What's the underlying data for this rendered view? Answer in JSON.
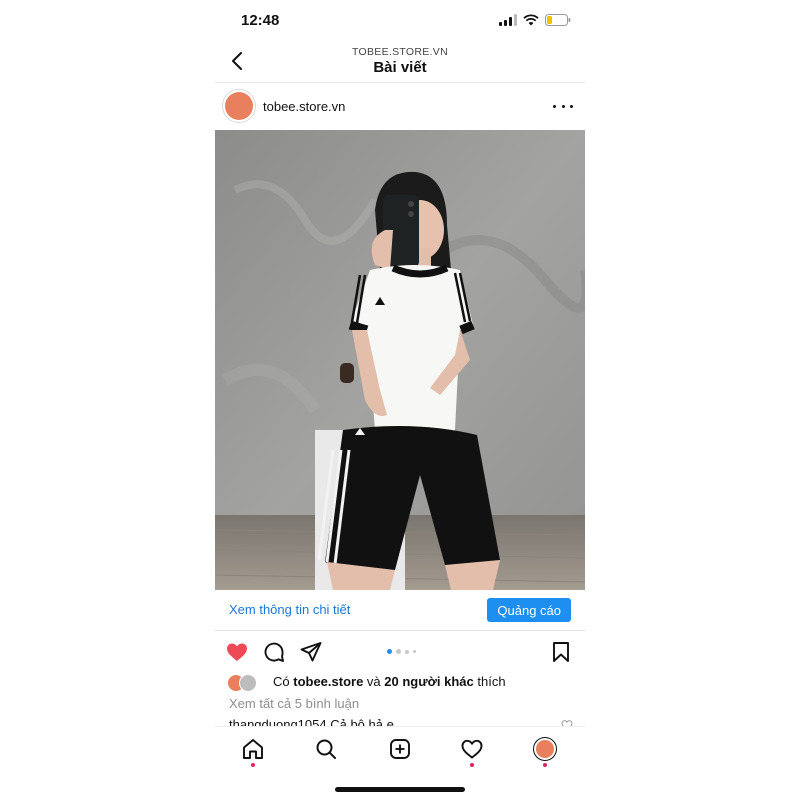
{
  "status_bar": {
    "time": "12:48"
  },
  "header": {
    "subtitle": "TOBEE.STORE.VN",
    "title": "Bài viết"
  },
  "post": {
    "username": "tobee.store.vn",
    "avatar_label": "tobee store",
    "image_icon": "adidas-white-tee-black-shorts-photo"
  },
  "cta": {
    "link_label": "Xem thông tin chi tiết",
    "button_label": "Quảng cáo"
  },
  "carousel": {
    "current_slide": 1,
    "slide_count": 4
  },
  "likes": {
    "prefix": "Có ",
    "user": "tobee.store",
    "middle": " và ",
    "others": "20 người khác",
    "suffix": " thích"
  },
  "comments": {
    "view_all": "Xem tất cả 5 bình luận",
    "preview_user": "thangduong1054",
    "preview_text": " Cả bộ hả e"
  },
  "colors": {
    "accent_blue": "#1c8ff0",
    "link_blue": "#1a78d8",
    "like_red": "#ed4956",
    "avatar_orange": "#e8805e"
  },
  "icons": {
    "back": "chevron-left-icon",
    "more": "more-horizontal-icon",
    "like": "heart-filled-icon",
    "comment": "comment-icon",
    "share": "paper-plane-icon",
    "save": "bookmark-icon",
    "nav_home": "home-icon",
    "nav_search": "search-icon",
    "nav_create": "add-post-icon",
    "nav_activity": "heart-outline-icon",
    "nav_profile": "profile-avatar-icon"
  }
}
